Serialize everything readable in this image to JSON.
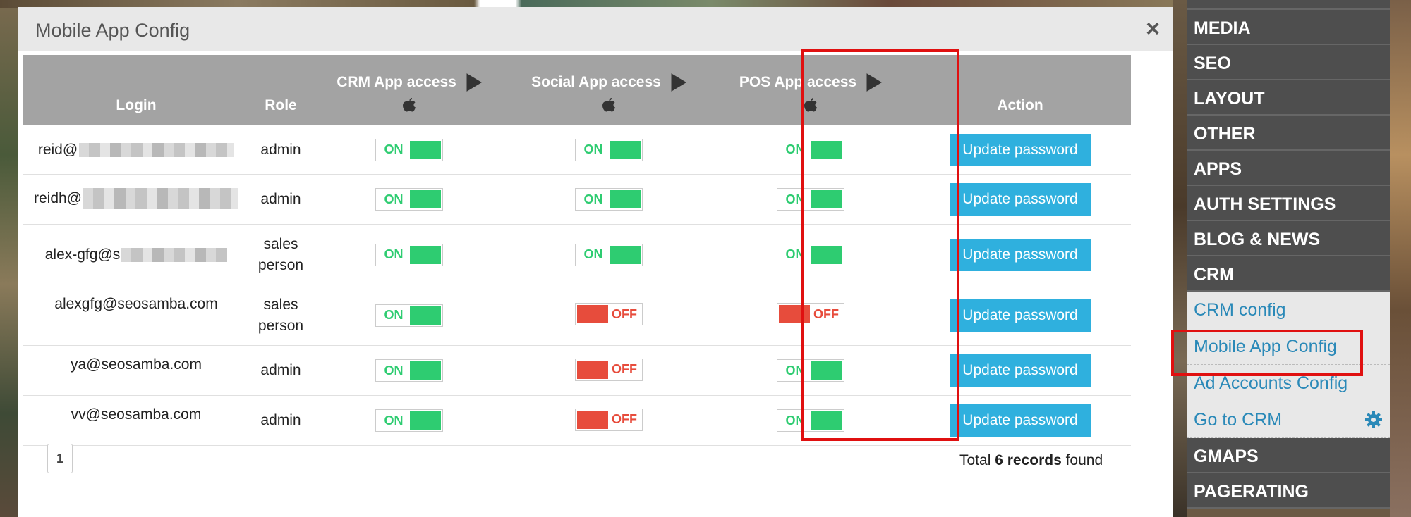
{
  "modal": {
    "title": "Mobile App Config",
    "close": "×"
  },
  "table": {
    "headers": {
      "login": "Login",
      "role": "Role",
      "crm": "CRM App access",
      "social": "Social App access",
      "pos": "POS App access",
      "action": "Action"
    },
    "rows": [
      {
        "login": "reid@",
        "role": "admin",
        "crm": "ON",
        "social": "ON",
        "pos": "ON",
        "action": "Update password"
      },
      {
        "login": "reidh@",
        "role": "admin",
        "crm": "ON",
        "social": "ON",
        "pos": "ON",
        "action": "Update password"
      },
      {
        "login": "alex-gfg@s",
        "role_1": "sales",
        "role_2": "person",
        "crm": "ON",
        "social": "ON",
        "pos": "ON",
        "action": "Update password"
      },
      {
        "login": "alexgfg@seosamba.com",
        "role_1": "sales",
        "role_2": "person",
        "crm": "ON",
        "social": "OFF",
        "pos": "OFF",
        "action": "Update password"
      },
      {
        "login": "ya@seosamba.com",
        "role": "admin",
        "crm": "ON",
        "social": "OFF",
        "pos": "ON",
        "action": "Update password"
      },
      {
        "login": "vv@seosamba.com",
        "role": "admin",
        "crm": "ON",
        "social": "OFF",
        "pos": "ON",
        "action": "Update password"
      }
    ]
  },
  "pagination": {
    "page": "1"
  },
  "footer": {
    "total_prefix": "Total ",
    "total_count": "6 records",
    "total_suffix": " found"
  },
  "sidebar": {
    "items": [
      "MEDIA",
      "SEO",
      "LAYOUT",
      "OTHER",
      "APPS",
      "AUTH SETTINGS",
      "BLOG & NEWS",
      "CRM"
    ],
    "crm_sub": [
      "CRM config",
      "Mobile App Config",
      "Ad Accounts Config",
      "Go to CRM"
    ],
    "items_after": [
      "GMAPS",
      "PAGERATING"
    ]
  },
  "colors": {
    "on": "#2ecc71",
    "off": "#e74c3c",
    "button": "#2fb0de",
    "header": "#a3a3a3",
    "highlight": "#e01010",
    "link": "#2a89b8"
  },
  "icons": {
    "play": "google-play-icon",
    "apple": "apple-icon",
    "gear": "gear-icon"
  }
}
